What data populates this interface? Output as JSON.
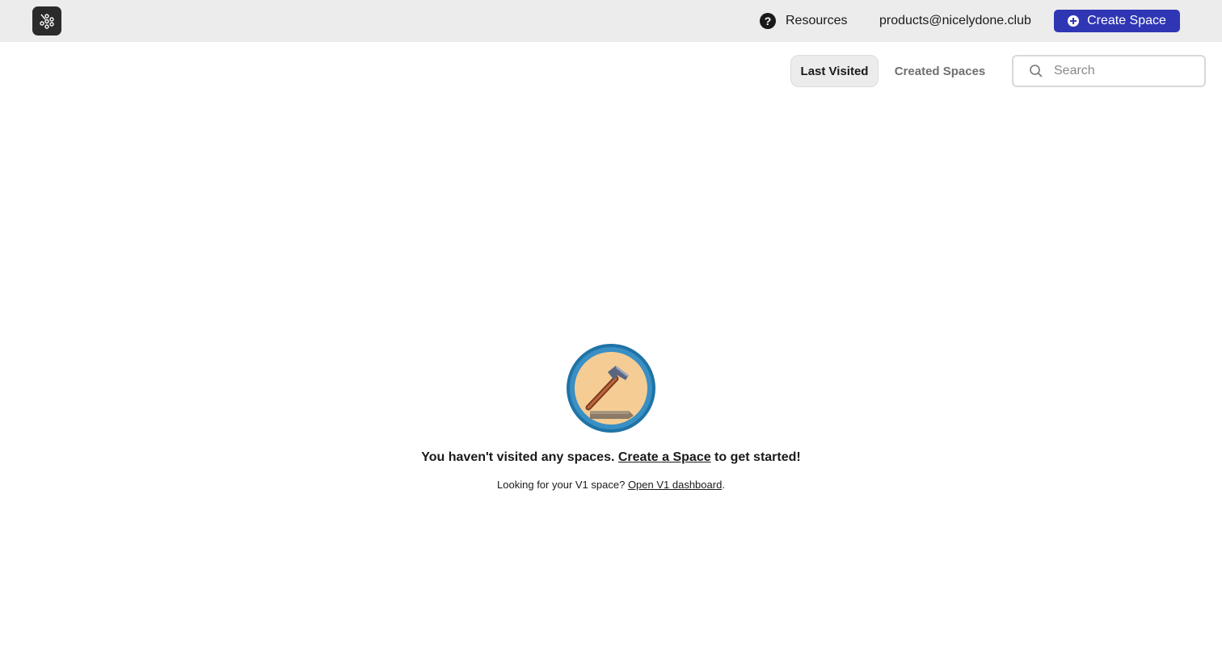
{
  "header": {
    "resources_label": "Resources",
    "account_email": "products@nicelydone.club",
    "create_space_label": "Create Space"
  },
  "tabs": [
    {
      "label": "Last Visited",
      "active": true
    },
    {
      "label": "Created Spaces",
      "active": false
    }
  ],
  "search": {
    "placeholder": "Search",
    "value": ""
  },
  "empty_state": {
    "message_prefix": "You haven't visited any spaces. ",
    "message_link": "Create a Space",
    "message_suffix": " to get started!",
    "v1_prefix": "Looking for your V1 space? ",
    "v1_link": "Open V1 dashboard",
    "v1_suffix": "."
  },
  "colors": {
    "accent": "#2f36b3",
    "topbar": "#ececec",
    "badge_ring": "#1f73a6",
    "badge_fill": "#f5cd94"
  }
}
